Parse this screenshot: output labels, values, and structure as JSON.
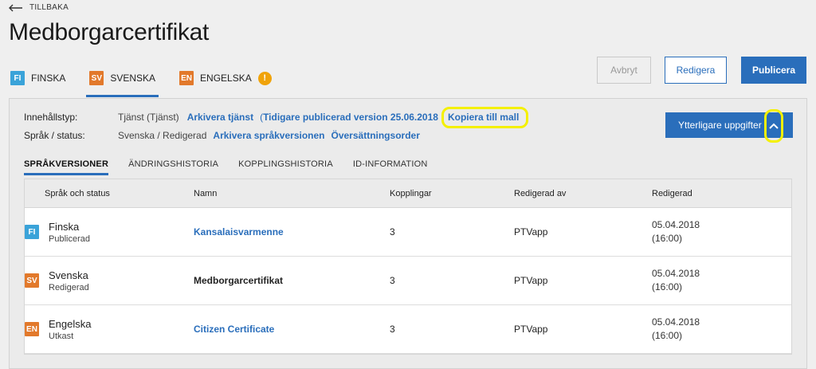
{
  "back_label": "TILLBAKA",
  "title": "Medborgarcertifikat",
  "language_tabs": [
    {
      "code": "FI",
      "label": "FINSKA"
    },
    {
      "code": "SV",
      "label": "SVENSKA"
    },
    {
      "code": "EN",
      "label": "ENGELSKA",
      "warning": "!"
    }
  ],
  "buttons": {
    "cancel": "Avbryt",
    "edit": "Redigera",
    "publish": "Publicera",
    "more": "Ytterligare uppgifter"
  },
  "info": {
    "content_type_label": "Innehållstyp:",
    "content_type_value": "Tjänst (Tjänst)",
    "archive_service": "Arkivera tjänst",
    "previous_version_prefix": "(",
    "previous_version": "Tidigare publicerad version 25.06.2018",
    "copy_to_template": "Kopiera till mall",
    "lang_status_label": "Språk / status:",
    "lang_status_value": "Svenska / Redigerad",
    "archive_language_version": "Arkivera språkversionen",
    "translation_order": "Översättningsorder"
  },
  "sub_tabs": [
    "SPRÅKVERSIONER",
    "ÄNDRINGSHISTORIA",
    "KOPPLINGSHISTORIA",
    "ID-INFORMATION"
  ],
  "table": {
    "headers": [
      "Språk och status",
      "Namn",
      "Kopplingar",
      "Redigerad av",
      "Redigerad"
    ],
    "rows": [
      {
        "code": "FI",
        "language": "Finska",
        "status": "Publicerad",
        "name": "Kansalaisvarmenne",
        "connections": "3",
        "edited_by": "PTVapp",
        "date": "05.04.2018",
        "time": "(16:00)"
      },
      {
        "code": "SV",
        "language": "Svenska",
        "status": "Redigerad",
        "name": "Medborgarcertifikat",
        "connections": "3",
        "edited_by": "PTVapp",
        "date": "05.04.2018",
        "time": "(16:00)"
      },
      {
        "code": "EN",
        "language": "Engelska",
        "status": "Utkast",
        "name": "Citizen Certificate",
        "connections": "3",
        "edited_by": "PTVapp",
        "date": "05.04.2018",
        "time": "(16:00)"
      }
    ]
  },
  "colors": {
    "accent": "#2a6ebb",
    "fi_badge": "#3aa3d9",
    "sv_badge": "#e2792b",
    "en_badge": "#e2792b",
    "warning": "#f0a30a",
    "highlight": "#f4f000"
  }
}
